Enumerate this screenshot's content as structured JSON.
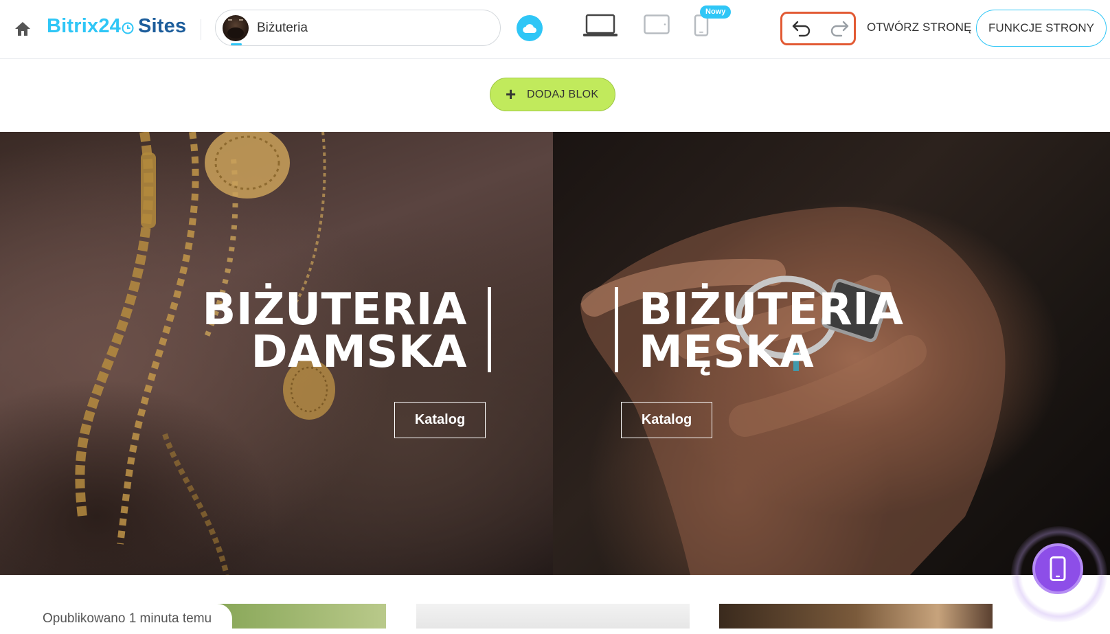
{
  "header": {
    "logo_brand": "Bitrix24",
    "logo_product": "Sites",
    "site_name": "Biżuteria",
    "new_badge": "Nowy",
    "open_page": "OTWÓRZ STRONĘ",
    "page_features": "FUNKCJE STRONY"
  },
  "toolbar": {
    "add_block": "DODAJ BLOK"
  },
  "hero": {
    "left": {
      "title_line1": "BIŻUTERIA",
      "title_line2": "DAMSKA",
      "button": "Katalog"
    },
    "right": {
      "title_line1": "BIŻUTERIA",
      "title_line2": "MĘSKA",
      "button": "Katalog"
    }
  },
  "status": {
    "published": "Opublikowano 1 minuta temu"
  },
  "icons": {
    "home": "home-icon",
    "cloud": "cloud-icon",
    "desktop": "laptop-icon",
    "tablet": "tablet-icon",
    "phone": "phone-icon",
    "undo": "undo-icon",
    "redo": "redo-icon",
    "mobile_preview": "smartphone-icon"
  },
  "colors": {
    "accent": "#2fc6f6",
    "logo_dark": "#1d5d9b",
    "add_block": "#c1ea5c",
    "highlight": "#e25a34",
    "mobile_button": "#8d4ee8"
  }
}
